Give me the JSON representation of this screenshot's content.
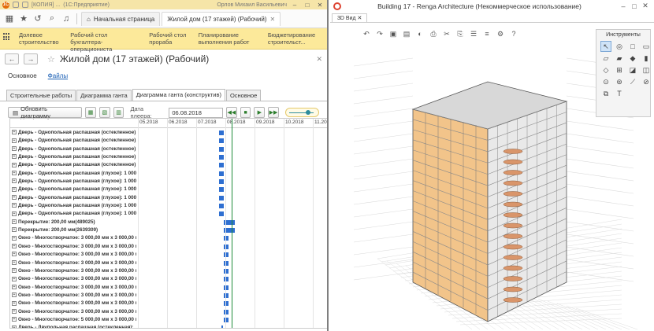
{
  "onec": {
    "titlebar": {
      "logo": "1С",
      "text1": "[КОПИЯ] ...",
      "text2": "(1С:Предприятие)",
      "user": "Орлов Михаил Васильевич"
    },
    "tabs": [
      {
        "label": "Начальная страница"
      },
      {
        "label": "Жилой дом (17 этажей) (Рабочий)"
      }
    ],
    "sections": [
      "Долевое строительство",
      "Рабочий стол бухгалтера-операциониста",
      "Рабочий стол прораба",
      "Планирование выполнения работ",
      "Бюджетирование строительст..."
    ],
    "form": {
      "title": "Жилой дом (17 этажей) (Рабочий)",
      "sub_current": "Основное",
      "sub_link": "Файлы"
    },
    "page_tabs": [
      "Строительные работы",
      "Диаграмма ганта",
      "Диаграмма ганта (конструктив)",
      "Основное"
    ],
    "toolbar": {
      "refresh_label": "Обновить диаграмму",
      "date_label": "Дата плеера:",
      "date_value": "06.08.2018",
      "slider_fraction": 0.8
    },
    "gantt": {
      "months": [
        "05.2018",
        "06.2018",
        "07.2018",
        "08.2018",
        "09.2018",
        "10.2018",
        "11.2018"
      ],
      "today_label": "06.08.2018",
      "rows": [
        {
          "name": "Дверь - Однопольная распашная (остекленное):...",
          "start": 0.285,
          "end": 0.3
        },
        {
          "name": "Дверь - Однопольная распашная (остекленное):...",
          "start": 0.285,
          "end": 0.3
        },
        {
          "name": "Дверь - Однопольная распашная (остекленное):...",
          "start": 0.285,
          "end": 0.3
        },
        {
          "name": "Дверь - Однопольная распашная (остекленное):...",
          "start": 0.285,
          "end": 0.3
        },
        {
          "name": "Дверь - Однопольная распашная (остекленное):...",
          "start": 0.285,
          "end": 0.3
        },
        {
          "name": "Дверь - Однопольная распашная (глухое): 1 000,0...",
          "start": 0.285,
          "end": 0.3
        },
        {
          "name": "Дверь - Однопольная распашная (глухое): 1 000,0...",
          "start": 0.285,
          "end": 0.3
        },
        {
          "name": "Дверь - Однопольная распашная (глухое): 1 000,0...",
          "start": 0.285,
          "end": 0.3
        },
        {
          "name": "Дверь - Однопольная распашная (глухое): 1 000,0...",
          "start": 0.285,
          "end": 0.3
        },
        {
          "name": "Дверь - Однопольная распашная (глухое): 1 000,0...",
          "start": 0.285,
          "end": 0.3
        },
        {
          "name": "Дверь - Однопольная распашная (глухое): 1 000,0...",
          "start": 0.285,
          "end": 0.3
        },
        {
          "name": "Перекрытие: 200,00 мм(489025)",
          "start": 0.3,
          "end": 0.335
        },
        {
          "name": "Перекрытие: 200,00 мм(2639309)",
          "start": 0.3,
          "end": 0.335
        },
        {
          "name": "Окно - Многостворчатое: 3 000,00 мм x 3 000,00 м...",
          "start": 0.3,
          "end": 0.315
        },
        {
          "name": "Окно - Многостворчатое: 3 000,00 мм x 3 000,00 м...",
          "start": 0.3,
          "end": 0.315
        },
        {
          "name": "Окно - Многостворчатое: 3 000,00 мм x 3 000,00 м...",
          "start": 0.3,
          "end": 0.315
        },
        {
          "name": "Окно - Многостворчатое: 3 000,00 мм x 3 000,00 м...",
          "start": 0.3,
          "end": 0.315
        },
        {
          "name": "Окно - Многостворчатое: 3 000,00 мм x 3 000,00 м...",
          "start": 0.3,
          "end": 0.315
        },
        {
          "name": "Окно - Многостворчатое: 3 000,00 мм x 3 000,00 м...",
          "start": 0.3,
          "end": 0.315
        },
        {
          "name": "Окно - Многостворчатое: 3 000,00 мм x 3 000,00 м...",
          "start": 0.3,
          "end": 0.315
        },
        {
          "name": "Окно - Многостворчатое: 3 000,00 мм x 3 000,00 м...",
          "start": 0.3,
          "end": 0.315
        },
        {
          "name": "Окно - Многостворчатое: 3 000,00 мм x 3 000,00 м...",
          "start": 0.3,
          "end": 0.315
        },
        {
          "name": "Окно - Многостворчатое: 3 000,00 мм x 3 000,00 м...",
          "start": 0.3,
          "end": 0.315
        },
        {
          "name": "Окно - Многостворчатое: 5 000,00 мм x 3 000,00 м...",
          "start": 0.3,
          "end": 0.315
        },
        {
          "name": "Дверь - Двупольная распашная (остекленная):...",
          "start": 0.292,
          "end": 0.296
        }
      ]
    }
  },
  "renga": {
    "title": "Building 17 - Renga Architecture (Некоммерческое использование)",
    "view_tab": "3D Вид",
    "tools_title": "Инструменты",
    "colors": {
      "facade": "#f2c48a",
      "frame": "#8a8a8a",
      "grid": "#d9d9d9"
    }
  }
}
